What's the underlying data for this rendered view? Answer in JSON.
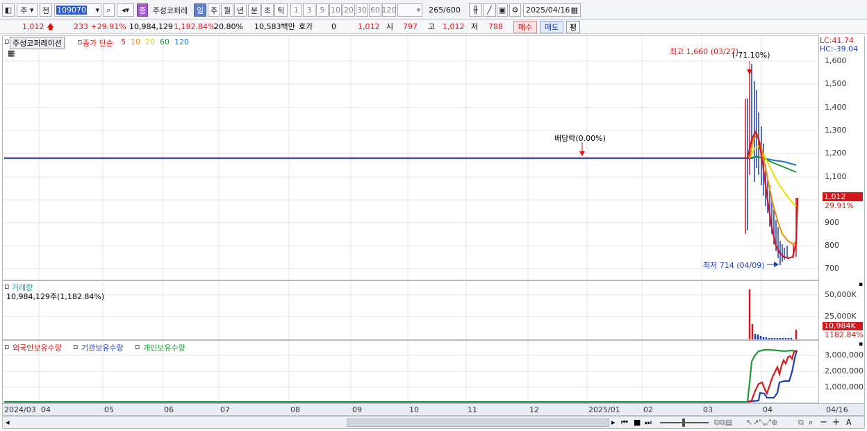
{
  "toolbar": {
    "market": "주",
    "prev": "전",
    "code": "109070",
    "name": "주성코퍼레",
    "periods": [
      "일",
      "주",
      "월",
      "년",
      "분",
      "초",
      "틱"
    ],
    "active_period": "일",
    "intervals": [
      "1",
      "3",
      "5",
      "10",
      "20",
      "30",
      "60",
      "120"
    ],
    "count": "265",
    "max": "/600",
    "date": "2025/04/16"
  },
  "quote": {
    "price": "1,012",
    "change": "233",
    "change_pct": "+29.91%",
    "volume": "10,984,129",
    "volume_pct": "1,182.84%",
    "turnover": "20.80%",
    "amount": "10,583백만",
    "hoga_label": "호가",
    "hoga_value": "0",
    "hoga_price": "1,012",
    "open_label": "시",
    "open": "797",
    "high_label": "고",
    "high": "1,012",
    "low_label": "저",
    "low": "788",
    "buy": "매수",
    "sell": "매도",
    "eval": "평"
  },
  "price_panel": {
    "stock_label": "주성코퍼레이션",
    "ma_label": "종가 단순",
    "ma_periods": [
      "5",
      "10",
      "20",
      "60",
      "120"
    ],
    "ma_colors": [
      "#d4171a",
      "#f08c00",
      "#f2d900",
      "#1e9a3a",
      "#1e6fd0"
    ],
    "high_annot": "최고 1,660 (03/27)",
    "high_pct": "(-71.10%)",
    "low_annot": "최저 714 (04/09)",
    "div_annot": "배당락(0.00%)",
    "lc": "LC:41.74",
    "hc": "HC:-39.04",
    "cur_price": "1,012",
    "cur_pct": "29.91%",
    "yticks": [
      "1,600",
      "1,500",
      "1,400",
      "1,300",
      "1,200",
      "1,100",
      "900",
      "800",
      "700"
    ]
  },
  "volume_panel": {
    "title": "거래량",
    "value": "10,984,129주(1,182.84%)",
    "yticks": [
      "50,000K",
      "25,000K"
    ],
    "cur": "10,984K",
    "cur_pct": "1182.84%"
  },
  "holding_panel": {
    "foreign": "외국인보유수량",
    "institution": "기관보유수량",
    "individual": "개인보유수량",
    "yticks": [
      "3,000,000",
      "2,000,000",
      "1,000,000"
    ]
  },
  "xaxis": [
    "2024/03",
    "04",
    "05",
    "06",
    "07",
    "08",
    "09",
    "10",
    "11",
    "12",
    "2025/01",
    "02",
    "03",
    "04"
  ],
  "xaxis_right": "04/16",
  "chart_data": {
    "type": "line",
    "baseline_price": 1180,
    "y_range": [
      650,
      1700
    ],
    "high": {
      "date": "03/27",
      "value": 1660
    },
    "low": {
      "date": "04/09",
      "value": 714
    },
    "last": 1012
  }
}
